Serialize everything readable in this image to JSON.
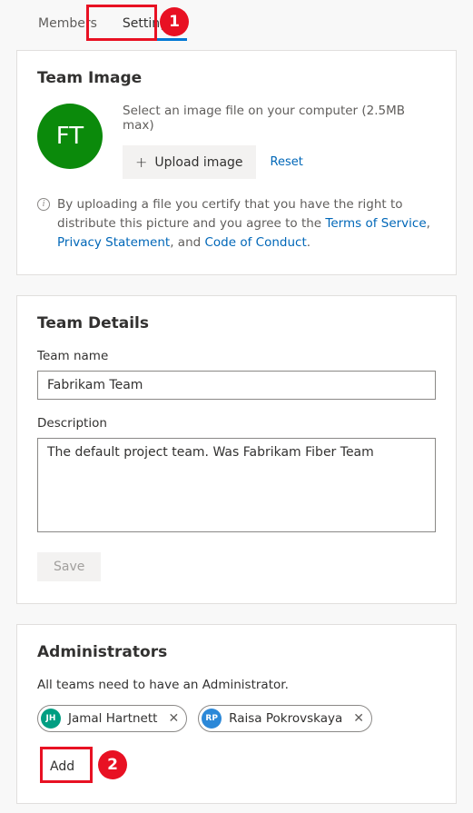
{
  "tabs": {
    "members": "Members",
    "settings": "Settings"
  },
  "callouts": {
    "n1": "1",
    "n2": "2"
  },
  "teamImage": {
    "title": "Team Image",
    "initials": "FT",
    "hint": "Select an image file on your computer (2.5MB max)",
    "uploadLabel": "Upload image",
    "resetLabel": "Reset",
    "disclaimerPre": "By uploading a file you certify that you have the right to distribute this picture and you agree to the ",
    "tos": "Terms of Service",
    "sep1": ", ",
    "privacy": "Privacy Statement",
    "sep2": ", and ",
    "coc": "Code of Conduct",
    "period": "."
  },
  "teamDetails": {
    "title": "Team Details",
    "nameLabel": "Team name",
    "nameValue": "Fabrikam Team",
    "descLabel": "Description",
    "descValue": "The default project team. Was Fabrikam Fiber Team",
    "saveLabel": "Save"
  },
  "admins": {
    "title": "Administrators",
    "hint": "All teams need to have an Administrator.",
    "people": [
      {
        "initials": "JH",
        "name": "Jamal Hartnett"
      },
      {
        "initials": "RP",
        "name": "Raisa Pokrovskaya"
      }
    ],
    "addLabel": "Add"
  }
}
